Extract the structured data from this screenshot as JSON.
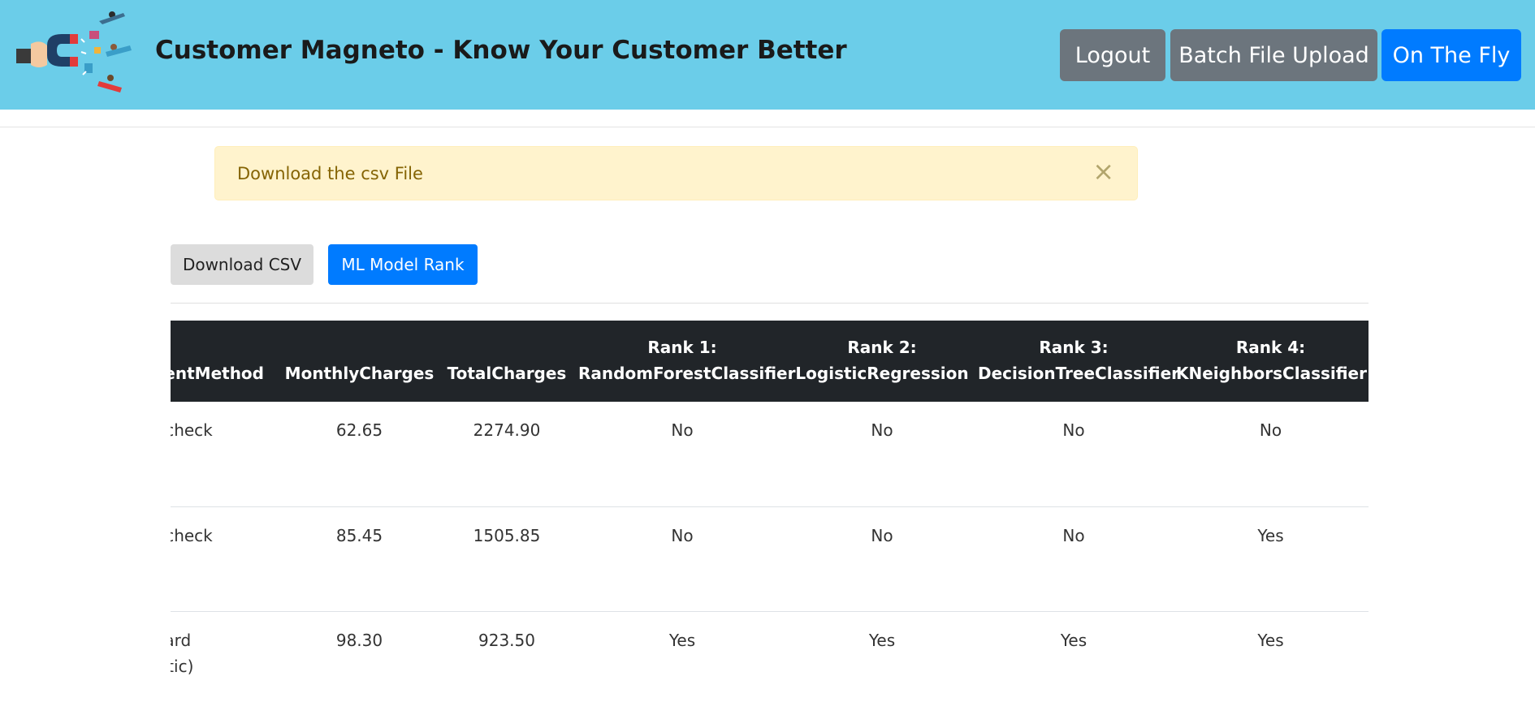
{
  "header": {
    "brand": "Customer Magneto - Know Your Customer Better",
    "buttons": {
      "logout": "Logout",
      "batch_upload": "Batch File Upload",
      "on_the_fly": "On The Fly"
    }
  },
  "alert": {
    "message": "Download the csv File",
    "close": "×"
  },
  "actions": {
    "download_csv": "Download CSV",
    "ml_model_rank": "ML Model Rank"
  },
  "table": {
    "headers": [
      "PaymentMethod",
      "MonthlyCharges",
      "TotalCharges",
      "Rank 1:\nRandomForestClassifier",
      "Rank 2:\nLogisticRegression",
      "Rank 3:\nDecisionTreeClassifier",
      "Rank 4:\nKNeighborsClassifier"
    ],
    "rows": [
      [
        "Electronic check",
        "62.65",
        "2274.90",
        "No",
        "No",
        "No",
        "No"
      ],
      [
        "Electronic check",
        "85.45",
        "1505.85",
        "No",
        "No",
        "No",
        "Yes"
      ],
      [
        "Credit card\n(automatic)",
        "98.30",
        "923.50",
        "Yes",
        "Yes",
        "Yes",
        "Yes"
      ]
    ]
  },
  "colors": {
    "navbar": "#6bcde9",
    "primary": "#007bff",
    "secondary": "#6c757d",
    "alert_bg": "#fff3cd",
    "table_header": "#212529"
  }
}
